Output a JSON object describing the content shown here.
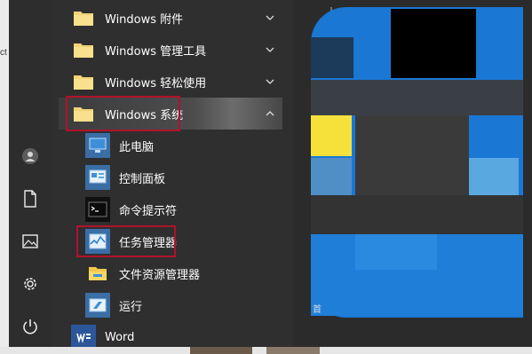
{
  "background": {
    "fragment_text": "ct"
  },
  "start_menu": {
    "left_strip": [
      {
        "name": "user-avatar-icon",
        "label": "user"
      },
      {
        "name": "documents-icon",
        "label": "documents"
      },
      {
        "name": "pictures-icon",
        "label": "pictures"
      },
      {
        "name": "settings-gear-icon",
        "label": "settings"
      },
      {
        "name": "power-icon",
        "label": "power"
      }
    ],
    "app_list": {
      "items": [
        {
          "label": "Windows 附件",
          "type": "folder",
          "state": "collapsed"
        },
        {
          "label": "Windows 管理工具",
          "type": "folder",
          "state": "collapsed"
        },
        {
          "label": "Windows 轻松使用",
          "type": "folder",
          "state": "collapsed"
        },
        {
          "label": "Windows 系统",
          "type": "folder",
          "state": "expanded",
          "highlighted": true
        },
        {
          "label": "此电脑",
          "type": "app",
          "icon": "computer-icon"
        },
        {
          "label": "控制面板",
          "type": "app",
          "icon": "control-panel-icon"
        },
        {
          "label": "命令提示符",
          "type": "app",
          "icon": "command-prompt-icon"
        },
        {
          "label": "任务管理器",
          "type": "app",
          "icon": "task-manager-icon",
          "highlighted": true
        },
        {
          "label": "文件资源管理器",
          "type": "app",
          "icon": "file-explorer-icon"
        },
        {
          "label": "运行",
          "type": "app",
          "icon": "run-icon"
        },
        {
          "label": "Word",
          "type": "app",
          "icon": "word-icon"
        }
      ]
    },
    "tile_area_text": "首"
  },
  "colors": {
    "highlight_border": "#b1122a",
    "tile_blue": "#1a78d4",
    "tile_yellow": "#f6e03a",
    "tile_light_blue": "#5aa8e0",
    "tile_dark": "#1c3a5a",
    "tile_black": "#000000",
    "menu_bg": "#2b2b2b"
  }
}
